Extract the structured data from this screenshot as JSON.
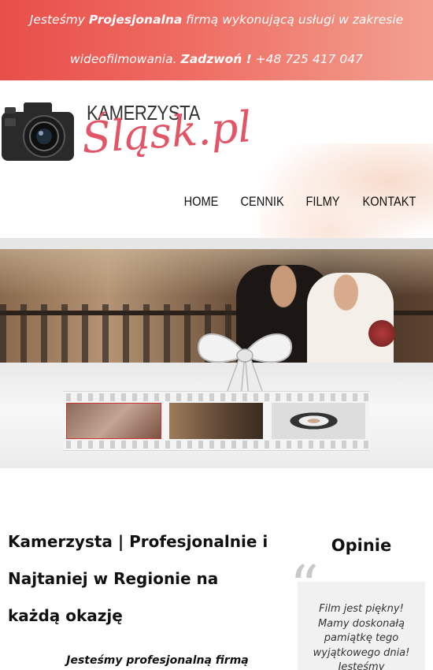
{
  "top_banner": {
    "line1_prefix": "Jesteśmy ",
    "line1_bold": "Projesjonalna",
    "line1_suffix": " firmą wykonującą usługi w zakresie",
    "line2_prefix": "wideofilmowania. ",
    "line2_bold": "Zadzwoń !",
    "line2_suffix": " +48 725 417 047"
  },
  "logo": {
    "top_text": "KAMERZYSTA",
    "script_text": "Śląsk.pl",
    "icon": "camera-icon"
  },
  "nav": {
    "items": [
      "HOME",
      "CENNIK",
      "FILMY",
      "KONTAKT"
    ]
  },
  "hero": {
    "decoration_icon": "bow-icon"
  },
  "gallery": {
    "thumbnail_count": 3
  },
  "content": {
    "heading": "Kamerzysta | Profesjonalnie i Najtaniej w Regionie na każdą okazję",
    "subheading": "Jesteśmy profesjonalną firmą"
  },
  "opinions": {
    "title": "Opinie",
    "quote_icon": "quote-icon",
    "text": "Film jest piękny! Mamy doskonałą pamiątkę tego wyjątkowego dnia! Jesteśmy"
  },
  "colors": {
    "banner_red": "#e84e4a",
    "logo_pink": "#e25566",
    "opinion_bg": "#f1f1f1"
  }
}
